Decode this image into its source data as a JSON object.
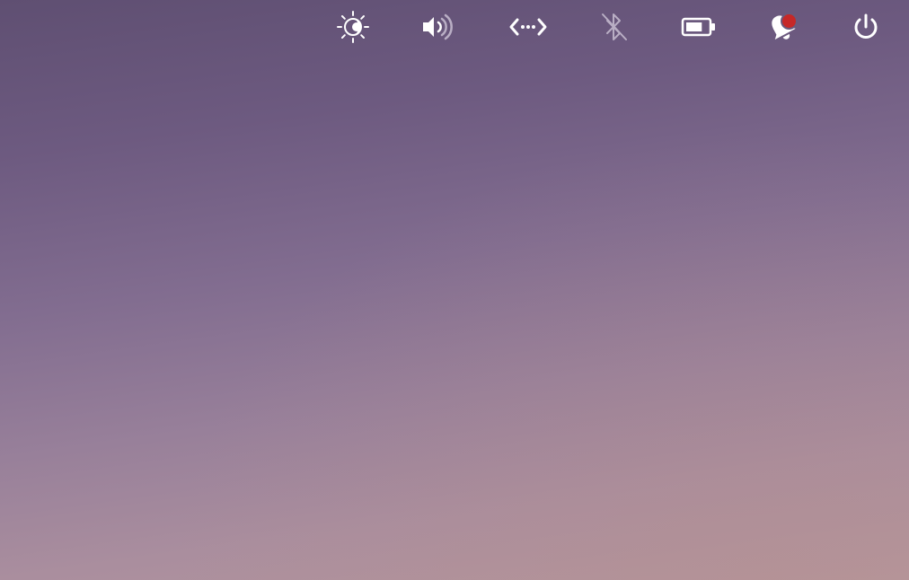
{
  "panel": {
    "indicators": [
      {
        "id": "brightness",
        "icon": "brightness-icon",
        "state": "on"
      },
      {
        "id": "sound",
        "icon": "volume-high-icon",
        "state": "on"
      },
      {
        "id": "network",
        "icon": "network-wired-icon",
        "state": "on"
      },
      {
        "id": "bluetooth",
        "icon": "bluetooth-disabled-icon",
        "state": "disabled"
      },
      {
        "id": "power",
        "icon": "battery-icon",
        "level": 0.75
      },
      {
        "id": "notifications",
        "icon": "bell-icon",
        "has_unread": true
      },
      {
        "id": "session",
        "icon": "power-icon"
      }
    ]
  },
  "colors": {
    "icon": "#ffffff",
    "icon_dimmed": "#b9aec4",
    "notification_badge": "#c62828",
    "wallpaper_top": "#5f4f72",
    "wallpaper_bottom": "#b6979c"
  }
}
